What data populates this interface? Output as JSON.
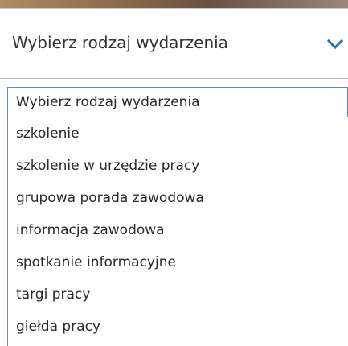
{
  "select": {
    "value": "Wybierz rodzaj wydarzenia",
    "icon": "chevron-down-icon",
    "accent_color": "#2f6fb0"
  },
  "options": [
    "Wybierz rodzaj wydarzenia",
    "szkolenie",
    "szkolenie w urzędzie pracy",
    "grupowa porada zawodowa",
    "informacja zawodowa",
    "spotkanie informacyjne",
    "targi pracy",
    "giełda pracy"
  ]
}
